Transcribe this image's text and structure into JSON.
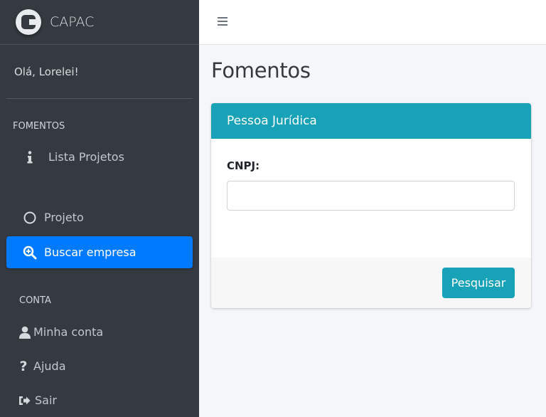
{
  "brand": {
    "name": "CAPAC"
  },
  "user": {
    "greeting": "Olá, Lorelei!"
  },
  "sidebar": {
    "sections": [
      {
        "header": "FOMENTOS"
      },
      {
        "header": "CONTA"
      }
    ],
    "items": [
      {
        "label": "Lista Projetos",
        "icon": "info-icon"
      },
      {
        "label": "Projeto",
        "icon": "circle-icon"
      },
      {
        "label": "Buscar empresa",
        "icon": "search-plus-icon",
        "active": true
      },
      {
        "label": "Minha conta",
        "icon": "user-icon"
      },
      {
        "label": "Ajuda",
        "icon": "question-icon"
      },
      {
        "label": "Sair",
        "icon": "sign-out-icon"
      }
    ]
  },
  "page": {
    "title": "Fomentos"
  },
  "card": {
    "header": "Pessoa Jurídica",
    "field_label": "CNPJ:",
    "field_value": "",
    "field_placeholder": "",
    "submit_label": "Pesquisar"
  },
  "colors": {
    "sidebar_bg": "#343a40",
    "active": "#007bff",
    "info": "#17a2b8"
  }
}
